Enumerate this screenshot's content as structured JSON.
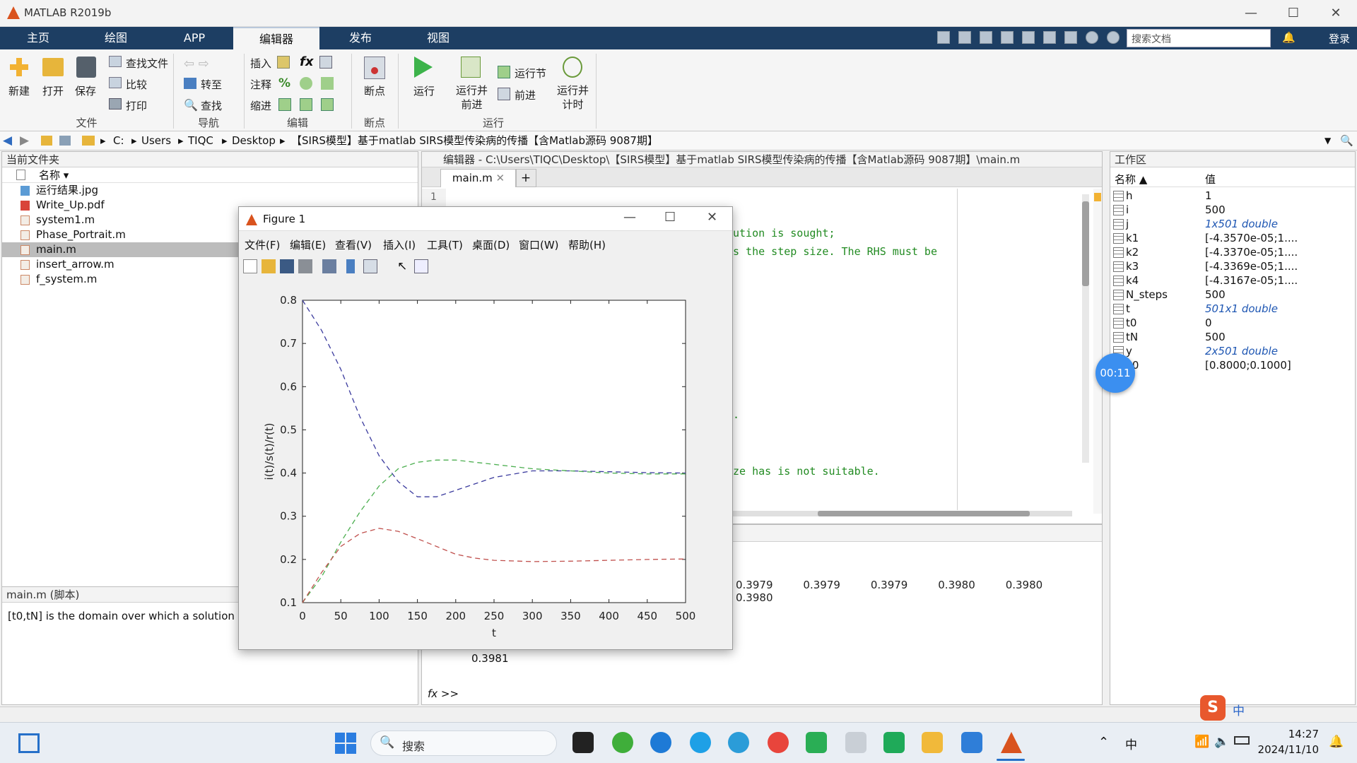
{
  "window": {
    "title": "MATLAB R2019b",
    "minimize": "—",
    "maximize": "☐",
    "close": "✕"
  },
  "ribbon": {
    "tabs": [
      "主页",
      "绘图",
      "APP",
      "编辑器",
      "发布",
      "视图"
    ],
    "active_tab": "编辑器",
    "search_placeholder": "搜索文档",
    "login": "登录",
    "file": {
      "new": "新建",
      "open": "打开",
      "save": "保存",
      "find_files": "查找文件",
      "compare": "比较",
      "print": "打印",
      "section": "文件"
    },
    "navigate": {
      "goto": "转至",
      "find": "查找",
      "section": "导航"
    },
    "edit": {
      "insert": "插入",
      "comment": "注释",
      "indent": "缩进",
      "fx": "fx",
      "percent": "%",
      "section": "编辑"
    },
    "breakpoints": {
      "label": "断点",
      "section": "断点"
    },
    "run": {
      "run": "运行",
      "run_advance": "运行并\n前进",
      "run_section": "运行节",
      "advance": "前进",
      "run_time": "运行并\n计时",
      "section": "运行"
    }
  },
  "address": {
    "parts": [
      "C:",
      "Users",
      "TIQC",
      "Desktop",
      "【SIRS模型】基于matlab SIRS模型传染病的传播【含Matlab源码 9087期】"
    ]
  },
  "current_folder": {
    "title": "当前文件夹",
    "column": "名称 ▾",
    "files": [
      "运行结果.jpg",
      "Write_Up.pdf",
      "system1.m",
      "Phase_Portrait.m",
      "main.m",
      "insert_arrow.m",
      "f_system.m"
    ],
    "selected": "main.m",
    "details_title": "main.m  (脚本)",
    "details_text": "[t0,tN] is the domain over which a solution is"
  },
  "editor": {
    "title": "编辑器 - C:\\Users\\TIQC\\Desktop\\【SIRS模型】基于matlab SIRS模型传染病的传播【含Matlab源码 9087期】\\main.m",
    "tab": "main.m",
    "add": "+",
    "line1": "1",
    "code_line_a": "ution is sought;",
    "code_line_b": "s the step size. The RHS must be",
    "code_line_c": ".",
    "code_line_d": "ze has is not suitable."
  },
  "command_window": {
    "values": [
      "0.3979",
      "0.3979",
      "0.3979",
      "0.3980",
      "0.3980",
      "0.3980"
    ],
    "last_value": "0.3981",
    "prompt": "fx  >>"
  },
  "workspace": {
    "title": "工作区",
    "col_name": "名称 ▲",
    "col_value": "值",
    "rows": [
      {
        "name": "h",
        "value": "1",
        "italic": false
      },
      {
        "name": "i",
        "value": "500",
        "italic": false
      },
      {
        "name": "j",
        "value": "1x501 double",
        "italic": true
      },
      {
        "name": "k1",
        "value": "[-4.3570e-05;1....",
        "italic": false
      },
      {
        "name": "k2",
        "value": "[-4.3370e-05;1....",
        "italic": false
      },
      {
        "name": "k3",
        "value": "[-4.3369e-05;1....",
        "italic": false
      },
      {
        "name": "k4",
        "value": "[-4.3167e-05;1....",
        "italic": false
      },
      {
        "name": "N_steps",
        "value": "500",
        "italic": false
      },
      {
        "name": "t",
        "value": "501x1 double",
        "italic": true
      },
      {
        "name": "t0",
        "value": "0",
        "italic": false
      },
      {
        "name": "tN",
        "value": "500",
        "italic": false
      },
      {
        "name": "y",
        "value": "2x501 double",
        "italic": true
      },
      {
        "name": "y0",
        "value": "[0.8000;0.1000]",
        "italic": false
      }
    ],
    "timer": "00:11"
  },
  "figure": {
    "title": "Figure 1",
    "menus": [
      "文件(F)",
      "编辑(E)",
      "查看(V)",
      "插入(I)",
      "工具(T)",
      "桌面(D)",
      "窗口(W)",
      "帮助(H)"
    ]
  },
  "chart_data": {
    "type": "line",
    "xlabel": "t",
    "ylabel": "i(t)/s(t)/r(t)",
    "xlim": [
      0,
      500
    ],
    "ylim": [
      0.1,
      0.8
    ],
    "xticks": [
      "0",
      "50",
      "100",
      "150",
      "200",
      "250",
      "300",
      "350",
      "400",
      "450",
      "500"
    ],
    "yticks": [
      "0.1",
      "0.2",
      "0.3",
      "0.4",
      "0.5",
      "0.6",
      "0.7",
      "0.8"
    ],
    "x": [
      0,
      25,
      50,
      75,
      100,
      125,
      150,
      175,
      200,
      225,
      250,
      300,
      350,
      400,
      450,
      500
    ],
    "series": [
      {
        "color": "#3b3b9e",
        "values": [
          0.8,
          0.73,
          0.64,
          0.53,
          0.44,
          0.38,
          0.345,
          0.345,
          0.36,
          0.375,
          0.39,
          0.405,
          0.405,
          0.403,
          0.401,
          0.4
        ]
      },
      {
        "color": "#4caf50",
        "values": [
          0.1,
          0.16,
          0.24,
          0.31,
          0.37,
          0.41,
          0.425,
          0.43,
          0.43,
          0.425,
          0.42,
          0.41,
          0.405,
          0.4,
          0.398,
          0.398
        ]
      },
      {
        "color": "#c0504d",
        "values": [
          0.1,
          0.17,
          0.23,
          0.26,
          0.272,
          0.265,
          0.248,
          0.23,
          0.212,
          0.203,
          0.198,
          0.195,
          0.196,
          0.198,
          0.2,
          0.201
        ]
      }
    ],
    "grid": false
  },
  "taskbar": {
    "search": "搜索",
    "time": "14:27",
    "date": "2024/11/10",
    "ime": "中"
  }
}
